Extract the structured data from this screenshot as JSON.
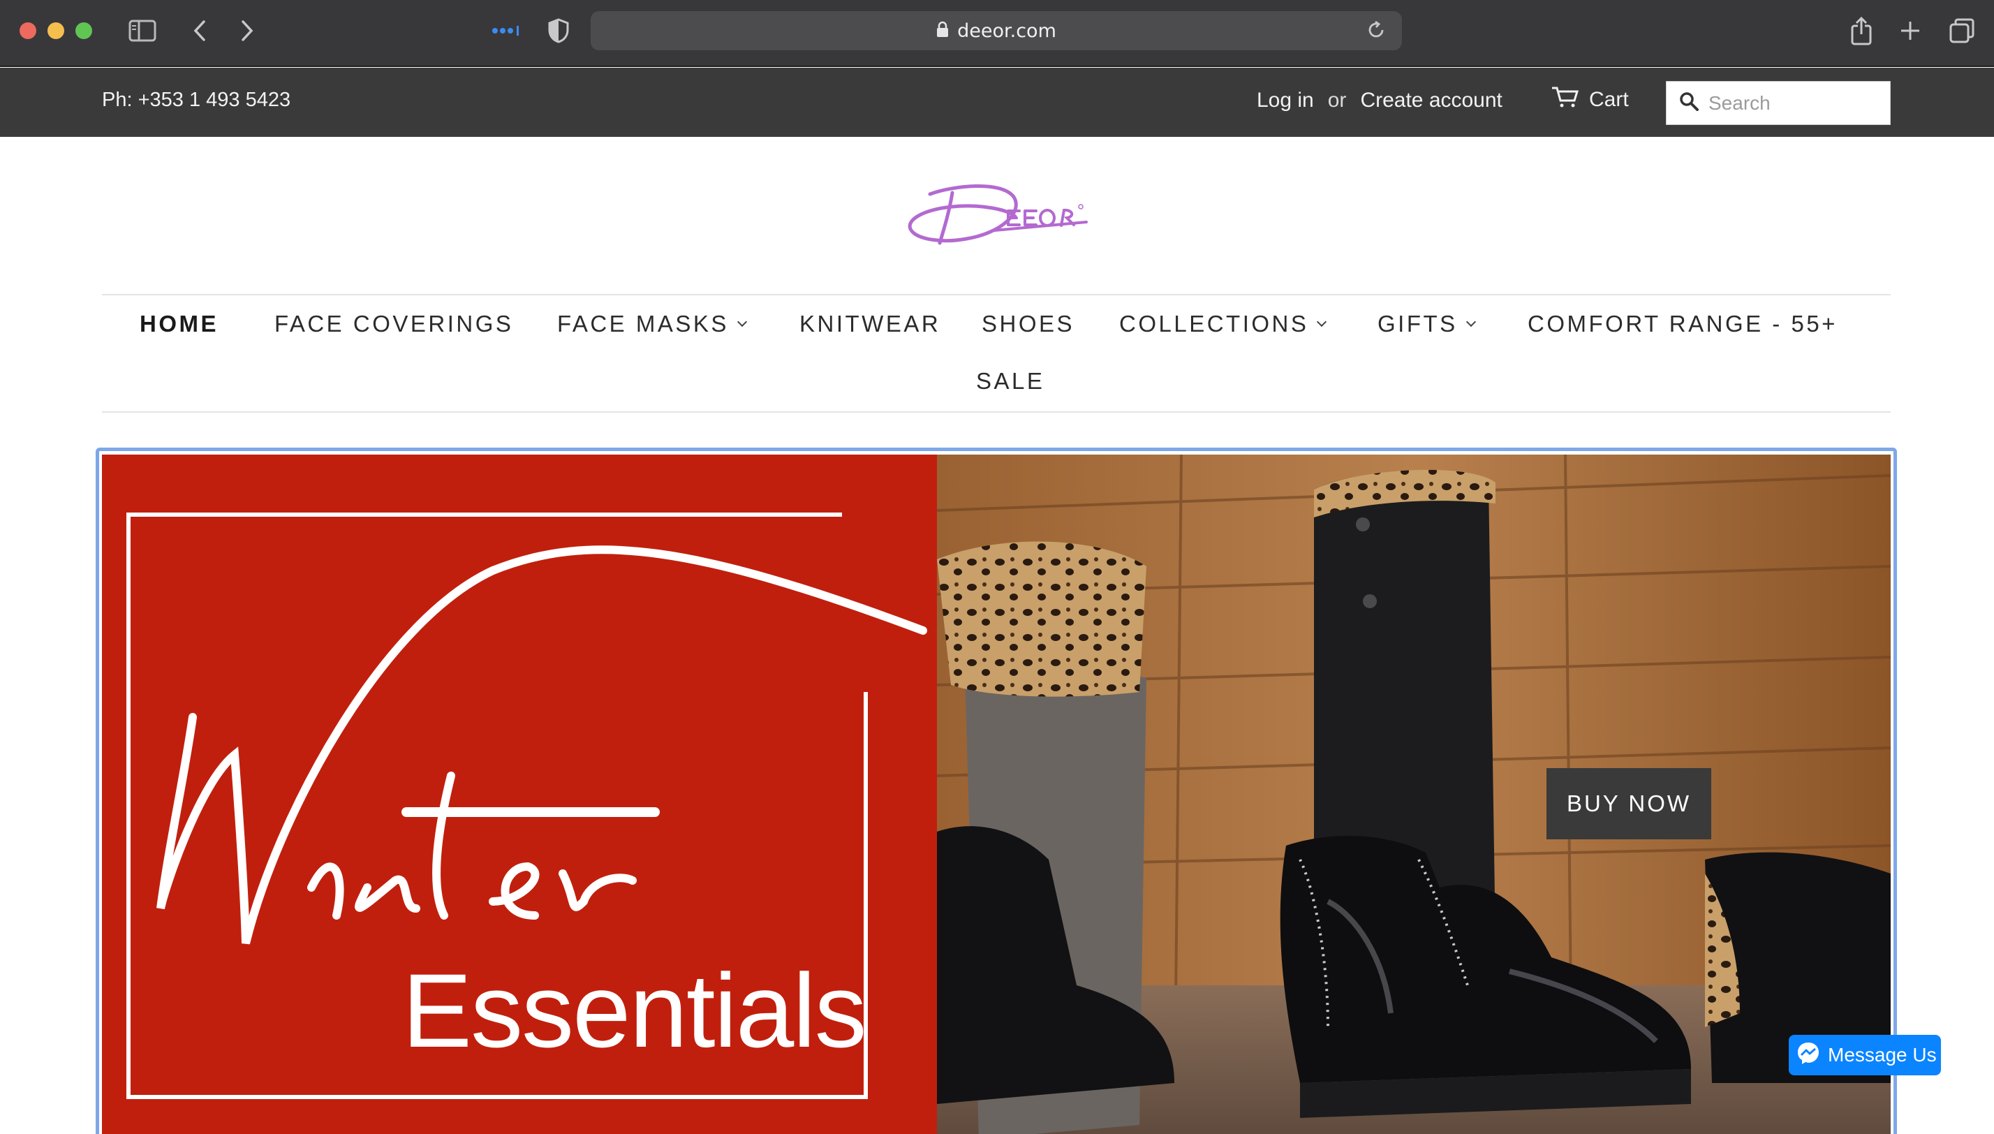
{
  "browser": {
    "url": "deeor.com",
    "icons": [
      "sidebar-icon",
      "back-icon",
      "forward-icon",
      "extensions-icon",
      "shield-icon",
      "lock-icon",
      "reload-icon",
      "share-icon",
      "new-tab-icon",
      "tabs-overview-icon"
    ]
  },
  "topbar": {
    "phone": "Ph: +353 1 493 5423",
    "login": "Log in",
    "or": "or",
    "create_account": "Create account",
    "cart": "Cart",
    "search_placeholder": "Search"
  },
  "nav": {
    "items": [
      {
        "label": "HOME",
        "active": true,
        "dropdown": false
      },
      {
        "label": "FACE COVERINGS",
        "active": false,
        "dropdown": false
      },
      {
        "label": "FACE MASKS",
        "active": false,
        "dropdown": true
      },
      {
        "label": "KNITWEAR",
        "active": false,
        "dropdown": false
      },
      {
        "label": "SHOES",
        "active": false,
        "dropdown": false
      },
      {
        "label": "COLLECTIONS",
        "active": false,
        "dropdown": true
      },
      {
        "label": "GIFTS",
        "active": false,
        "dropdown": true
      },
      {
        "label": "COMFORT RANGE - 55+",
        "active": false,
        "dropdown": false
      },
      {
        "label": "SALE",
        "active": false,
        "dropdown": false
      }
    ]
  },
  "hero": {
    "script_text": "Winter",
    "text": "Essentials",
    "cta": "BUY NOW"
  },
  "messenger": {
    "label": "Message Us"
  },
  "colors": {
    "chrome": "#38383b",
    "topbar": "#3a3a3a",
    "logo": "#b36ad0",
    "hero_red": "#c11f0d",
    "focus_outline": "#7ea7e8",
    "messenger": "#0b84ff"
  }
}
